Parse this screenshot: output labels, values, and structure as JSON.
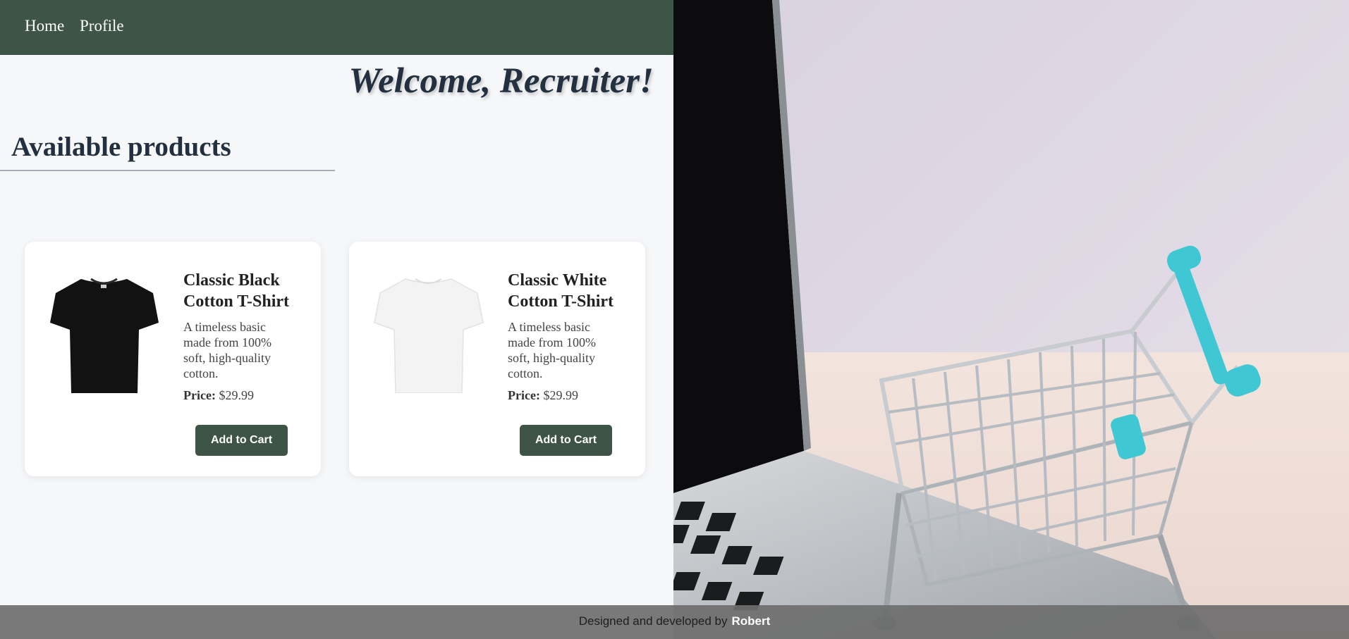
{
  "nav": {
    "home_label": "Home",
    "profile_label": "Profile"
  },
  "header": {
    "welcome": "Welcome, Recruiter!"
  },
  "products_section": {
    "title": "Available products"
  },
  "products": [
    {
      "name": "Classic Black Cotton T-Shirt",
      "description": "A timeless basic made from 100% soft, high-quality cotton.",
      "price_label": "Price:",
      "price": "$29.99",
      "button_label": "Add to Cart",
      "shirt_color": "#121212",
      "icon": "black-tshirt-image"
    },
    {
      "name": "Classic White Cotton T-Shirt",
      "description": "A timeless basic made from 100% soft, high-quality cotton.",
      "price_label": "Price:",
      "price": "$29.99",
      "button_label": "Add to Cart",
      "shirt_color": "#f3f3f3",
      "icon": "white-tshirt-image"
    }
  ],
  "footer": {
    "text": "Designed and developed by",
    "author": "Robert"
  },
  "colors": {
    "nav_bg": "#3e5446",
    "accent": "#3e5446",
    "heading": "#223040",
    "page_bg": "#f6f7f9"
  }
}
